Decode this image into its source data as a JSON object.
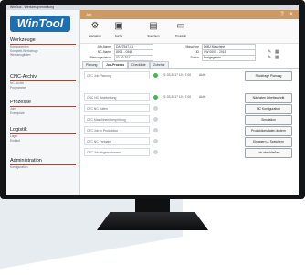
{
  "window": {
    "title": "WinTool - Werkzeugverwaltung"
  },
  "sidebar": {
    "logo": "WinTool",
    "sections": [
      {
        "title": "Werkzeuge",
        "items": [
          "Komponenten",
          "Komplett-Werkzeuge",
          "Werkzeuglisten"
        ]
      },
      {
        "title": "CNC-Archiv",
        "items": [
          "NC-Archiv",
          "Programme"
        ]
      },
      {
        "title": "Prozesse",
        "items": [
          "Jobs",
          "Exemplare"
        ]
      },
      {
        "title": "Logistik",
        "items": [
          "Lager",
          "Einkauf"
        ]
      },
      {
        "title": "Administration",
        "items": [
          "Konfiguration"
        ]
      }
    ]
  },
  "main": {
    "title": "Job",
    "toolbar": [
      "Navigation",
      "Suche",
      "Speichern",
      "Protokoll"
    ],
    "form": {
      "job_name_label": "Job-Name",
      "job_name_value": "DA27547-01",
      "nc_name_label": "NC-Name",
      "nc_name_value": "8001 - 0545",
      "planned_label": "Planungsdatum",
      "planned_value": "02.03.2017",
      "machine_label": "Maschine",
      "machine_value": "DMU Maschine",
      "id_label": "ID",
      "id_value": "VW 0001 - 2015",
      "status_label": "Status",
      "status_value": "Freigegeben"
    },
    "tabs": [
      "Planung",
      "Job-Prozess",
      "Checkliste",
      "Zubehör"
    ],
    "active_tab": 1,
    "rows": [
      {
        "label": "CTC Job Planung",
        "status_color": "#3fb950",
        "time": "21.03.2017 10:17:00",
        "state": "Aktiv",
        "button": "Rückfrage Planung"
      },
      {
        "label": "CNC NC Bearbeitung",
        "status_color": "#3fb950",
        "time": "21.03.2017 10:17:00",
        "state": "Aktiv",
        "button": "Nächsten Arbeitsschritt"
      },
      {
        "label": "CTC NC Daten",
        "status_color": "#cfd4d8",
        "time": "",
        "state": "",
        "button": "NC Konfiguration"
      },
      {
        "label": "CTC Maschinenüberprüfung",
        "status_color": "#cfd4d8",
        "time": "",
        "state": "",
        "button": "Simulation"
      },
      {
        "label": "CTC Job in Produktion",
        "status_color": "#cfd4d8",
        "time": "",
        "state": "",
        "button": "Produktionsdaten ändern"
      },
      {
        "label": "CTC NC Freigabe",
        "status_color": "#cfd4d8",
        "time": "",
        "state": "",
        "button": "Einlagern & Speichern"
      },
      {
        "label": "CTC Job abgeschlossen",
        "status_color": "#cfd4d8",
        "time": "",
        "state": "",
        "button": "Job abschließen"
      }
    ]
  }
}
